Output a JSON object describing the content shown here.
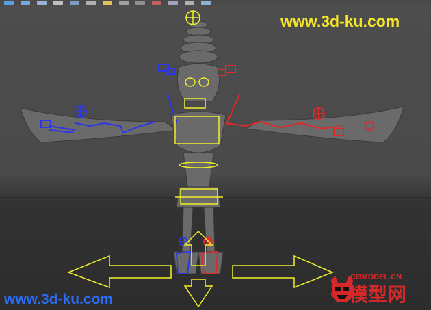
{
  "app": {
    "name": "3D modeling viewport"
  },
  "toolbar": {
    "buttons": [
      {
        "icon": "select-tool-icon",
        "color": "#5aa0e0"
      },
      {
        "icon": "cube-icon",
        "color": "#7aa8d8"
      },
      {
        "icon": "cube-wire-icon",
        "color": "#9ab4d8"
      },
      {
        "icon": "gear-icon",
        "color": "#c0c0c0"
      },
      {
        "icon": "sphere-icon",
        "color": "#7c9cc0"
      },
      {
        "icon": "shade-icon",
        "color": "#b0b0b0"
      },
      {
        "icon": "light-icon",
        "color": "#e0c060"
      },
      {
        "icon": "camera-icon",
        "color": "#a0a0a0"
      },
      {
        "icon": "isolate-icon",
        "color": "#909090"
      },
      {
        "icon": "xray-icon",
        "color": "#c06060"
      },
      {
        "icon": "frame-icon",
        "color": "#a0a0c0"
      },
      {
        "icon": "grid-icon",
        "color": "#b0b0b0"
      },
      {
        "icon": "render-icon",
        "color": "#90b0d0"
      }
    ]
  },
  "viewport": {
    "colors": {
      "background": "#4a4a4a",
      "ground": "#2e2e2e",
      "model": "#6e6e6e",
      "control_left": "#2a36e8",
      "control_right": "#e02a2a",
      "control_center": "#f0f02a"
    }
  },
  "watermarks": {
    "top": "www.3d-ku.com",
    "bottom": "www.3d-ku.com",
    "logo_url": "CGMODEL.CN",
    "logo_text": "模型网"
  }
}
